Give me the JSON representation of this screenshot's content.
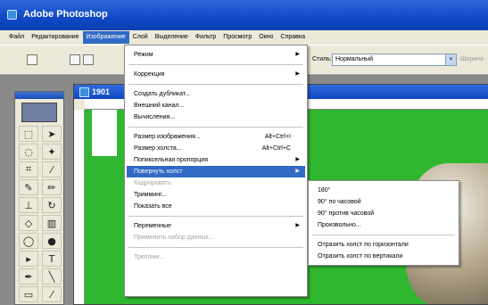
{
  "window": {
    "title": "Adobe Photoshop"
  },
  "menubar": {
    "items": [
      "Файл",
      "Редактирование",
      "Изображение",
      "Слой",
      "Выделение",
      "Фильтр",
      "Просмотр",
      "Окно",
      "Справка"
    ],
    "active_index": 2
  },
  "options_bar": {
    "mode_label": "Стиль:",
    "mode_value": "Нормальный",
    "tail_label": "Ширина"
  },
  "document": {
    "title": "1901"
  },
  "image_menu": {
    "items": [
      {
        "label": "Режим",
        "submenu": true
      },
      {
        "label": "Коррекция",
        "submenu": true
      },
      {
        "label": "Создать дубликат..."
      },
      {
        "label": "Внешний канал..."
      },
      {
        "label": "Вычисления..."
      },
      {
        "label": "Размер изображения...",
        "shortcut": "Alt+Ctrl+I"
      },
      {
        "label": "Размер холста...",
        "shortcut": "Alt+Ctrl+C"
      },
      {
        "label": "Попиксельная пропорция",
        "submenu": true
      },
      {
        "label": "Повернуть холст",
        "submenu": true,
        "highlighted": true
      },
      {
        "label": "Кадрировать",
        "disabled": true
      },
      {
        "label": "Тримминг..."
      },
      {
        "label": "Показать все"
      },
      {
        "label": "Переменные",
        "submenu": true
      },
      {
        "label": "Применить набор данных...",
        "disabled": true
      },
      {
        "label": "Треппинг...",
        "disabled": true
      }
    ]
  },
  "rotate_submenu": {
    "items": [
      {
        "label": "180°"
      },
      {
        "label": "90° по часовой"
      },
      {
        "label": "90° против часовой"
      },
      {
        "label": "Произвольно..."
      },
      {
        "label": "Отразить холст по горизонтали"
      },
      {
        "label": "Отразить холст по вертикали"
      }
    ]
  },
  "colors": {
    "titlebar": "#0f47c4",
    "highlight": "#316ac5",
    "canvas_bg": "#2fb82f",
    "chrome": "#ece9d8"
  }
}
